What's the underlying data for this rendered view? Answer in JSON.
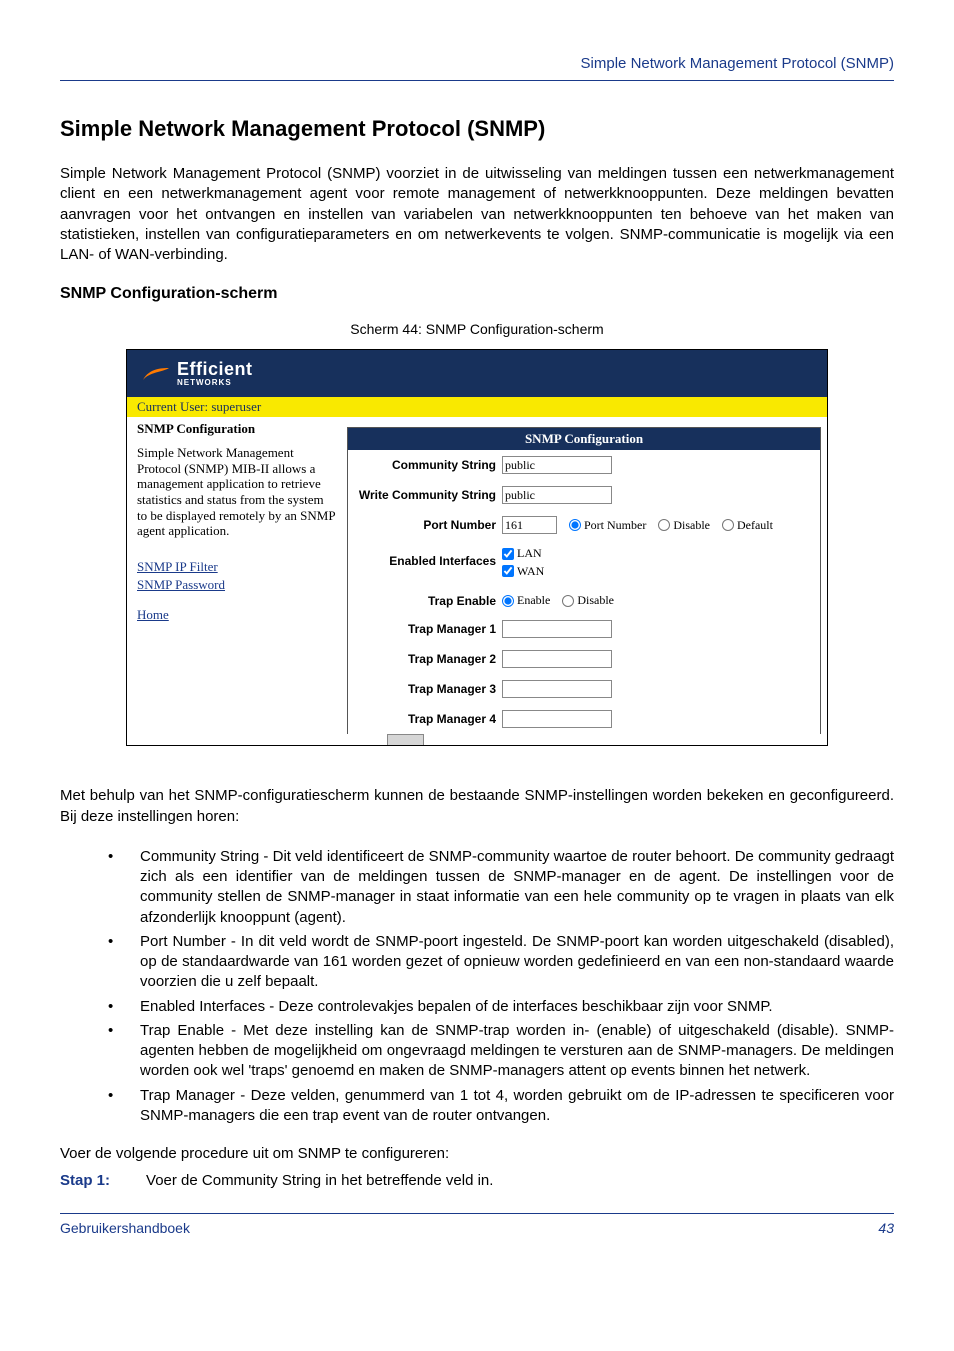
{
  "header": {
    "right_text": "Simple Network Management Protocol (SNMP)"
  },
  "section_title": "Simple Network Management Protocol (SNMP)",
  "intro": "Simple Network Management Protocol (SNMP) voorziet in de uitwisseling van meldingen tussen een netwerkmanagement client en een netwerkmanagement agent voor remote management of netwerkknooppunten. Deze meldingen bevatten aanvragen voor het ontvangen en instellen van variabelen van netwerkknooppunten ten behoeve van het maken van statistieken, instellen van configuratieparameters en om netwerkevents te volgen. SNMP-communicatie is mogelijk via een LAN- of WAN-verbinding.",
  "sub_title": "SNMP Configuration-scherm",
  "fig_caption": "Scherm 44: SNMP Configuration-scherm",
  "screenshot": {
    "logo_main": "Efficient",
    "logo_sub": "NETWORKS",
    "user_bar": "Current User: superuser",
    "left_title": "SNMP Configuration",
    "left_desc": "Simple Network Management Protocol (SNMP) MIB-II allows a management application to retrieve statistics and status from the system to be displayed remotely by an SNMP agent application.",
    "links": {
      "ip_filter": "SNMP IP Filter",
      "password": "SNMP Password",
      "home": "Home"
    },
    "panel_title": "SNMP Configuration",
    "labels": {
      "community_string": "Community String",
      "write_community_string": "Write Community String",
      "port_number": "Port Number",
      "enabled_interfaces": "Enabled Interfaces",
      "trap_enable": "Trap Enable",
      "trap_manager_1": "Trap Manager 1",
      "trap_manager_2": "Trap Manager 2",
      "trap_manager_3": "Trap Manager 3",
      "trap_manager_4": "Trap Manager 4"
    },
    "values": {
      "community_string": "public",
      "write_community_string": "public",
      "port_number": "161",
      "trap_manager_1": "",
      "trap_manager_2": "",
      "trap_manager_3": "",
      "trap_manager_4": ""
    },
    "radios": {
      "port_number": "Port Number",
      "disable": "Disable",
      "default": "Default",
      "enable": "Enable"
    },
    "checks": {
      "lan": "LAN",
      "wan": "WAN"
    }
  },
  "post_text": "Met behulp van het SNMP-configuratiescherm kunnen de bestaande SNMP-instellingen worden bekeken en geconfigureerd. Bij deze instellingen horen:",
  "bullets": [
    "Community String - Dit veld identificeert de SNMP-community waartoe de router behoort. De community gedraagt zich als een identifier van de meldingen tussen de SNMP-manager en de agent. De instellingen voor de community stellen de SNMP-manager in staat informatie van een hele community op te vragen in plaats van elk afzonderlijk knooppunt  (agent).",
    "Port Number - In dit veld wordt de SNMP-poort ingesteld. De SNMP-poort kan worden uitgeschakeld (disabled), op de standaardwarde van 161 worden gezet of opnieuw worden gedefinieerd en van een non-standaard waarde voorzien die u zelf bepaalt.",
    "Enabled Interfaces - Deze controlevakjes bepalen of de interfaces beschikbaar zijn voor SNMP.",
    "Trap Enable - Met deze instelling kan de SNMP-trap worden in- (enable) of uitgeschakeld (disable). SNMP-agenten hebben de mogelijkheid om ongevraagd meldingen te versturen aan de SNMP-managers. De meldingen worden ook wel 'traps' genoemd en maken de SNMP-managers attent op events binnen het netwerk.",
    "Trap Manager - Deze velden, genummerd van 1 tot 4, worden gebruikt om de IP-adressen te specificeren voor SNMP-managers die een trap event van de router ontvangen."
  ],
  "procedure_intro": "Voer de volgende procedure uit om SNMP te configureren:",
  "step": {
    "label": "Stap 1:",
    "text": "Voer de Community String in het betreffende veld in."
  },
  "footer": {
    "left": "Gebruikershandboek",
    "page": "43"
  }
}
